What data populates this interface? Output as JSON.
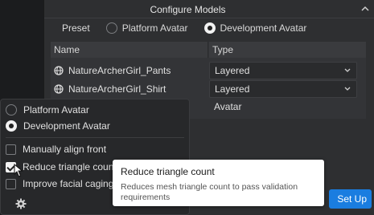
{
  "dialog": {
    "title": "Configure Models",
    "preset": {
      "label": "Preset",
      "options": [
        "Platform Avatar",
        "Development Avatar"
      ],
      "selected": "Development Avatar"
    },
    "table": {
      "columns": [
        "Name",
        "Type"
      ],
      "rows": [
        {
          "name": "NatureArcherGirl_Pants",
          "type": "Layered"
        },
        {
          "name": "NatureArcherGirl_Shirt",
          "type": "Layered"
        },
        {
          "name": "",
          "type": "Avatar"
        }
      ]
    },
    "set_up_button": "Set Up"
  },
  "panel": {
    "avatar_options": [
      "Platform Avatar",
      "Development Avatar"
    ],
    "avatar_selected": "Development Avatar",
    "checkboxes": [
      {
        "label": "Manually align front",
        "checked": false
      },
      {
        "label": "Reduce triangle count",
        "checked": true
      },
      {
        "label": "Improve facial caging",
        "checked": false
      }
    ]
  },
  "tooltip": {
    "title": "Reduce triangle count",
    "description": "Reduces mesh triangle count to pass validation requirements"
  },
  "colors": {
    "accent": "#1a7de0",
    "background": "#2e2f31"
  }
}
